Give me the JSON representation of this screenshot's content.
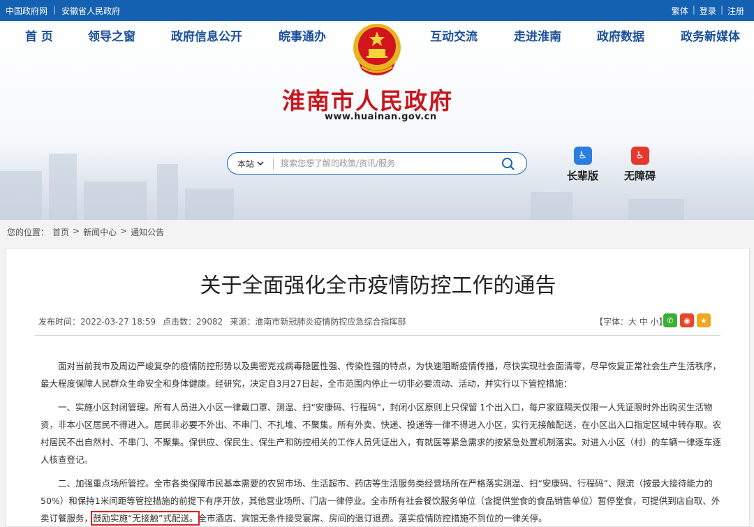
{
  "topbar": {
    "links_left": [
      "中国政府网",
      "安徽省人民政府"
    ],
    "links_right": [
      "繁体",
      "登录",
      "注册"
    ]
  },
  "nav": [
    "首 页",
    "领导之窗",
    "政府信息公开",
    "皖事通办",
    "互动交流",
    "走进淮南",
    "政府数据",
    "政务新媒体"
  ],
  "site": {
    "title": "淮南市人民政府",
    "url": "www.huainan.gov.cn"
  },
  "search": {
    "scope": "本站",
    "placeholder": "搜索您想了解的政策/资讯/服务"
  },
  "tools": {
    "elder": "长辈版",
    "accessible": "无障碍"
  },
  "breadcrumb": {
    "prefix": "您的位置：",
    "items": [
      "首页",
      "新闻中心",
      "通知公告"
    ],
    "sep": ">"
  },
  "article": {
    "title": "关于全面强化全市疫情防控工作的通告",
    "published": "发布时间：2022-03-27 18:59",
    "hits": "点击数：29082",
    "source": "来源：淮南市新冠肺炎疫情防控应急综合指挥部",
    "font_size": "【字体：大 中 小】",
    "p1": "面对当前我市及周边严峻复杂的疫情防控形势以及奥密克戎病毒隐匿性强、传染性强的特点，为快速阻断疫情传播，尽快实现社会面清零，尽早恢复正常社会生产生活秩序，最大程度保障人民群众生命安全和身体健康。经研究，决定自3月27日起，全市范围内停止一切非必要流动、活动，并实行以下管控措施：",
    "p2": "一、实施小区封闭管理。所有人员进入小区一律戴口罩、测温、扫“安康码、行程码”，封闭小区原则上只保留 1个出入口，每户家庭隔天仅限一人凭证限时外出购买生活物资，非本小区居民不得进入。居民非必要不外出、不串门、不扎堆、不聚集。所有外卖、快递、投递等一律不得进入小区，实行无接触配送，在小区出入口指定区域中转存取。农村居民不出自然村、不串门、不聚集。保供应、保民生、保生产和防控相关的工作人员凭证出入，有就医等紧急需求的按紧急处置机制落实。对进入小区（村）的车辆一律逐车逐人核查登记。",
    "p3_before": "二、加强重点场所管控。全市各类保障市民基本需要的农贸市场、生活超市、药店等生活服务类经营场所在严格落实测温、扫“安康码、行程码”、限流（按最大接待能力的50%）和保持1米间距等管控措施的前提下有序开放，其他营业场所、门店一律停业。全市所有社会餐饮服务单位（含提供堂食的食品销售单位）暂停堂食，可提供到店自取、外卖订餐服务，",
    "p3_highlight": "鼓励实施“无接触”式配送。",
    "p3_after": "全市酒店、宾馆无条件接受宴席、房间的退订退费。落实疫情防控措施不到位的一律关停。"
  },
  "colors": {
    "topbar": "#1561b1",
    "nav_text": "#1a4f9c",
    "title_red": "#c8161d",
    "highlight": "#e02020"
  }
}
